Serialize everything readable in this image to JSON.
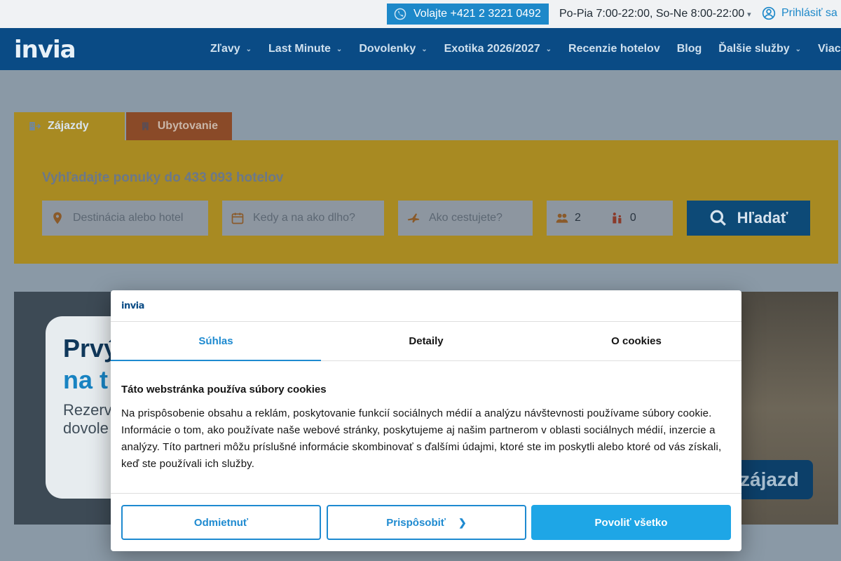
{
  "topbar": {
    "phone_label": "Volajte +421 2 3221 0492",
    "hours": "Po-Pia 7:00-22:00, So-Ne 8:00-22:00",
    "login_label": "Prihlásiť sa"
  },
  "brand": {
    "logo_text": "invia"
  },
  "nav": {
    "items": [
      {
        "label": "Zľavy",
        "has_dropdown": true
      },
      {
        "label": "Last Minute",
        "has_dropdown": true
      },
      {
        "label": "Dovolenky",
        "has_dropdown": true
      },
      {
        "label": "Exotika 2026/2027",
        "has_dropdown": true
      },
      {
        "label": "Recenzie hotelov",
        "has_dropdown": false
      },
      {
        "label": "Blog",
        "has_dropdown": false
      },
      {
        "label": "Ďalšie služby",
        "has_dropdown": true
      },
      {
        "label": "Viac",
        "has_dropdown": true
      }
    ]
  },
  "search": {
    "tabs": [
      {
        "label": "Zájazdy",
        "active": true
      },
      {
        "label": "Ubytovanie",
        "active": false
      }
    ],
    "title": "Vyhľadajte ponuky do 433 093 hotelov",
    "destination_placeholder": "Destinácia alebo hotel",
    "date_placeholder": "Kedy a na ako dlho?",
    "transport_placeholder": "Ako cestujete?",
    "adults": "2",
    "children": "0",
    "button_label": "Hľadať"
  },
  "banner": {
    "heading_1": "Prvý",
    "heading_2": "na t",
    "text_line_1": "Rezerv",
    "text_line_2": "dovole",
    "cta_label": "zájazd"
  },
  "cookie_modal": {
    "logo_text": "invia",
    "tabs": [
      {
        "label": "Súhlas",
        "active": true
      },
      {
        "label": "Detaily",
        "active": false
      },
      {
        "label": "O cookies",
        "active": false
      }
    ],
    "title": "Táto webstránka používa súbory cookies",
    "body": "Na prispôsobenie obsahu a reklám, poskytovanie funkcií sociálnych médií a analýzu návštevnosti používame súbory cookie. Informácie o tom, ako používate naše webové stránky, poskytujeme aj našim partnerom v oblasti sociálnych médií, inzercie a analýzy. Títo partneri môžu príslušné informácie skombinovať s ďalšími údajmi, ktoré ste im poskytli alebo ktoré od vás získali, keď ste používali ich služby.",
    "decline_label": "Odmietnuť",
    "customize_label": "Prispôsobiť",
    "allow_label": "Povoliť všetko"
  },
  "colors": {
    "nav_bg": "#0a4b85",
    "accent": "#1e8ad0",
    "search_panel": "#a88a22",
    "allow_button": "#1ea6e6"
  }
}
